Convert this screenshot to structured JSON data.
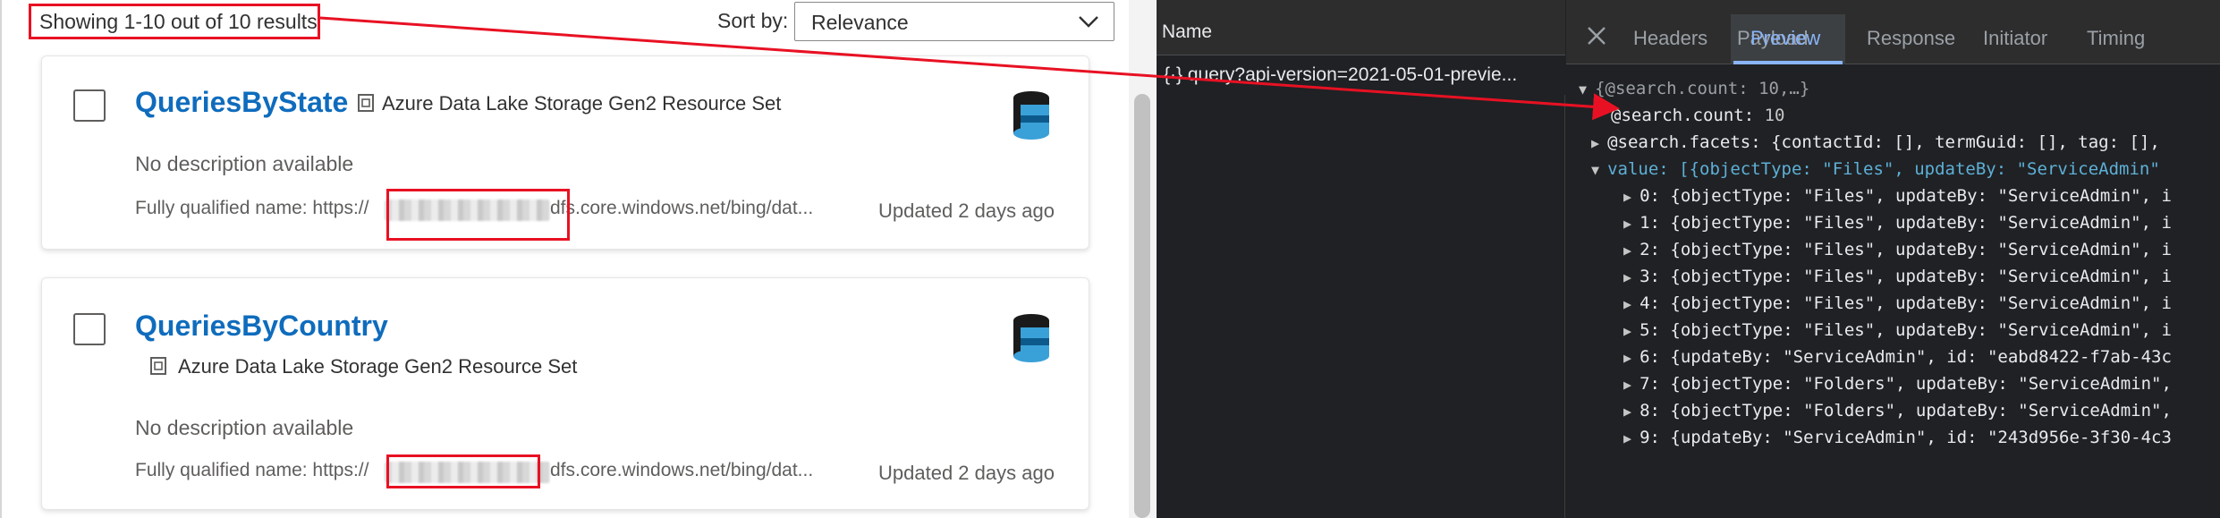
{
  "search": {
    "results_count": "Showing 1-10 out of 10 results",
    "sort_label": "Sort by:",
    "sort_value": "Relevance"
  },
  "results": [
    {
      "title": "QueriesByState",
      "type": "Azure Data Lake Storage Gen2 Resource Set",
      "description": "No description available",
      "fqn_prefix": "Fully qualified name: https://",
      "fqn_suffix": "dfs.core.windows.net/bing/dat...",
      "updated": "Updated 2 days ago"
    },
    {
      "title": "QueriesByCountry",
      "type": "Azure Data Lake Storage Gen2 Resource Set",
      "description": "No description available",
      "fqn_prefix": "Fully qualified name: https://",
      "fqn_suffix": "dfs.core.windows.net/bing/dat...",
      "updated": "Updated 2 days ago"
    }
  ],
  "devtools": {
    "name_header": "Name",
    "request": "{·} query?api-version=2021-05-01-previe...",
    "tabs": [
      "Headers",
      "Payload",
      "Preview",
      "Response",
      "Initiator",
      "Timing"
    ],
    "active_tab": "Preview",
    "json_root": "{@search.count: 10,…}",
    "count_key": "@search.count:",
    "count_value": "10",
    "facets_line": "@search.facets: {contactId: [], termGuid: [], tag: [],",
    "value_line": "value: [{objectType: \"Files\", updateBy: \"ServiceAdmin\"",
    "items": [
      "0: {objectType: \"Files\", updateBy: \"ServiceAdmin\", i",
      "1: {objectType: \"Files\", updateBy: \"ServiceAdmin\", i",
      "2: {objectType: \"Files\", updateBy: \"ServiceAdmin\", i",
      "3: {objectType: \"Files\", updateBy: \"ServiceAdmin\", i",
      "4: {objectType: \"Files\", updateBy: \"ServiceAdmin\", i",
      "5: {objectType: \"Files\", updateBy: \"ServiceAdmin\", i",
      "6: {updateBy: \"ServiceAdmin\", id: \"eabd8422-f7ab-43c",
      "7: {objectType: \"Folders\", updateBy: \"ServiceAdmin\",",
      "8: {objectType: \"Folders\", updateBy: \"ServiceAdmin\",",
      "9: {updateBy: \"ServiceAdmin\", id: \"243d956e-3f30-4c3"
    ]
  },
  "colors": {
    "link_blue": "#0f6cbd",
    "highlight_red": "#e81123",
    "devtools_bg": "#202124",
    "tab_active": "#8ab4f8"
  },
  "icons": [
    "chevron-down-icon",
    "close-icon",
    "resource-set-icon",
    "data-lake-icon",
    "expand-triangle-icon",
    "annotation-arrow"
  ]
}
